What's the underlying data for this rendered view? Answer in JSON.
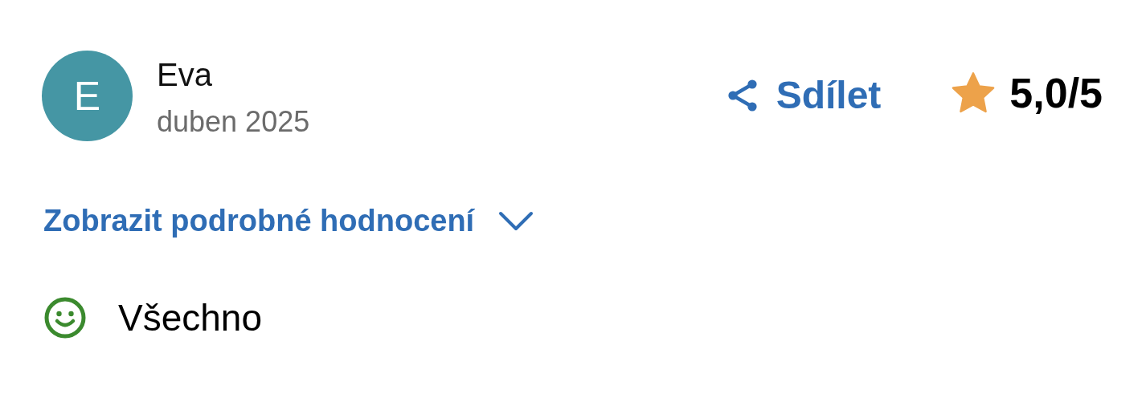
{
  "review": {
    "avatar_letter": "E",
    "author": "Eva",
    "date": "duben 2025",
    "share": {
      "label": "Sdílet"
    },
    "rating": "5,0/5",
    "details_toggle": {
      "label": "Zobrazit podrobné hodnocení",
      "expanded": false
    },
    "sentiments": [
      {
        "kind": "positive",
        "text": "Všechno"
      }
    ]
  }
}
